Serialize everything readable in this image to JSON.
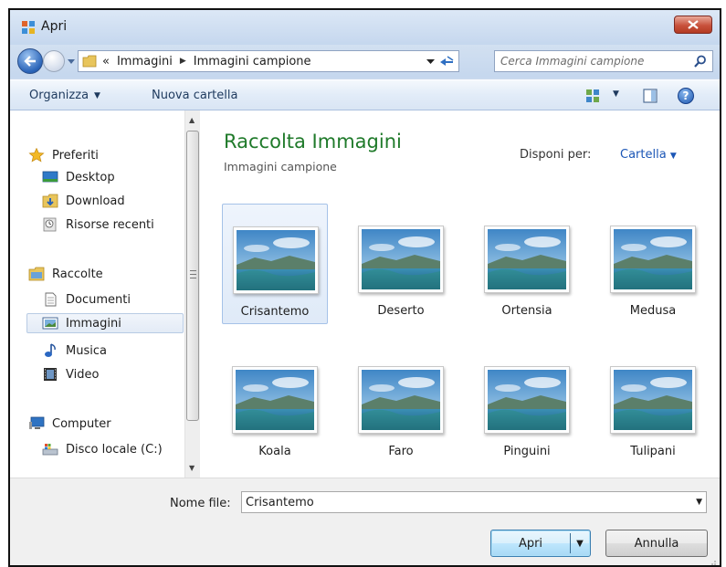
{
  "window": {
    "title": "Apri"
  },
  "navigation": {
    "breadcrumb": [
      {
        "label": "«"
      },
      {
        "label": "Immagini"
      },
      {
        "label": "Immagini campione"
      }
    ],
    "search_placeholder": "Cerca Immagini campione"
  },
  "toolbar": {
    "organize_label": "Organizza",
    "new_folder_label": "Nuova cartella",
    "help_label": "?"
  },
  "sidebar": {
    "favorites": {
      "label": "Preferiti",
      "items": [
        {
          "label": "Desktop",
          "icon": "desktop-icon"
        },
        {
          "label": "Download",
          "icon": "download-folder-icon"
        },
        {
          "label": "Risorse recenti",
          "icon": "recent-places-icon"
        }
      ]
    },
    "libraries": {
      "label": "Raccolte",
      "items": [
        {
          "label": "Documenti",
          "icon": "documents-icon"
        },
        {
          "label": "Immagini",
          "icon": "pictures-icon",
          "selected": true
        },
        {
          "label": "Musica",
          "icon": "music-icon"
        },
        {
          "label": "Video",
          "icon": "video-icon"
        }
      ]
    },
    "computer": {
      "label": "Computer",
      "items": [
        {
          "label": "Disco locale (C:)",
          "icon": "local-disk-icon"
        }
      ]
    }
  },
  "main": {
    "library_title": "Raccolta Immagini",
    "library_subtitle": "Immagini campione",
    "arrange_label": "Disponi per:",
    "arrange_value": "Cartella",
    "files": [
      {
        "name": "Crisantemo",
        "selected": true
      },
      {
        "name": "Deserto"
      },
      {
        "name": "Ortensia"
      },
      {
        "name": "Medusa"
      },
      {
        "name": "Koala"
      },
      {
        "name": "Faro"
      },
      {
        "name": "Pinguini"
      },
      {
        "name": "Tulipani"
      }
    ]
  },
  "footer": {
    "filename_label": "Nome file:",
    "filename_value": "Crisantemo",
    "open_label": "Apri",
    "cancel_label": "Annulla"
  },
  "colors": {
    "title_green": "#1f7a2a",
    "link_blue": "#1b56b6",
    "selection_bg": "#dfeaf8"
  }
}
